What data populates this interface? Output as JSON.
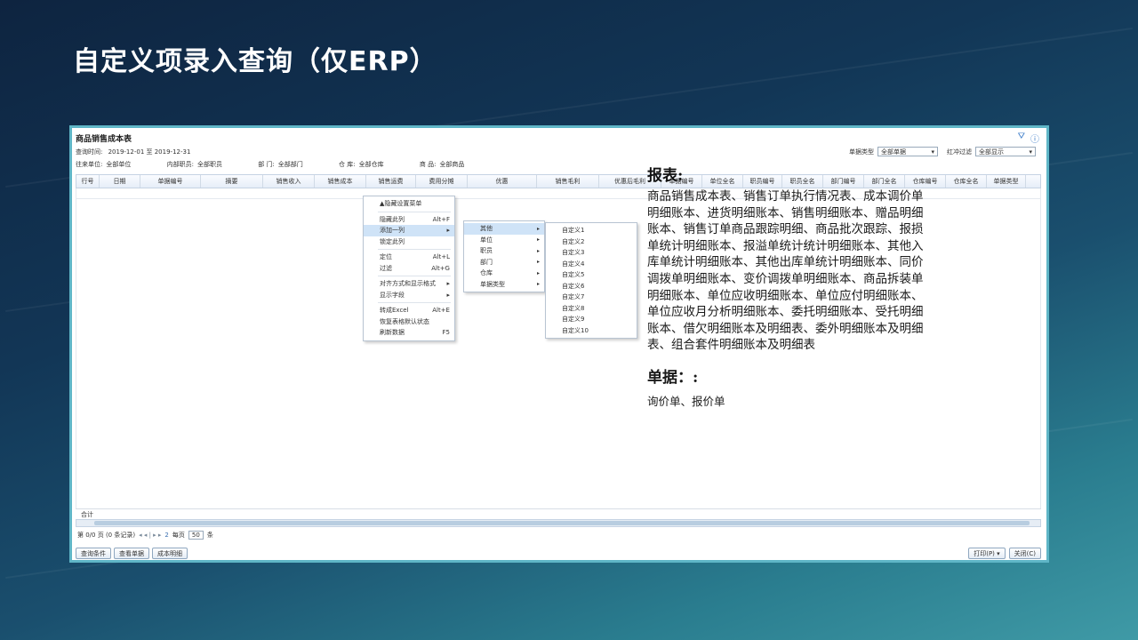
{
  "slide": {
    "title": "自定义项录入查询（仅ERP）"
  },
  "window": {
    "title": "商品销售成本表",
    "filter_icon": "filter-icon",
    "help_icon": "help-icon",
    "date_label": "查询时间:",
    "date_value": "2019-12-01 至 2019-12-31",
    "unit_label": "往来单位:",
    "unit_value": "全部单位",
    "staff_label": "内部职员:",
    "staff_value": "全部职员",
    "dept_label": "部 门:",
    "dept_value": "全部部门",
    "warehouse_label": "仓 库:",
    "warehouse_value": "全部仓库",
    "goods_label": "商 品:",
    "goods_value": "全部商品",
    "doc_type_label": "单据类型",
    "doc_type_value": "全部单据",
    "red_filter_label": "红冲过滤",
    "red_filter_value": "全部显示"
  },
  "columns": [
    "行号",
    "日期",
    "单据编号",
    "摘要",
    "销售收入",
    "销售成本",
    "销售运费",
    "费用分摊",
    "优惠",
    "销售毛利",
    "优惠后毛利",
    "单据编号",
    "单位全名",
    "职员编号",
    "职员全名",
    "部门编号",
    "部门全名",
    "仓库编号",
    "仓库全名",
    "单据类型"
  ],
  "menu1": [
    {
      "label": "▲隐藏设置菜单",
      "shortcut": ""
    },
    {
      "sep": true
    },
    {
      "label": "隐藏此列",
      "shortcut": "Alt+F"
    },
    {
      "label": "添加一列",
      "shortcut": "▸",
      "hl": true
    },
    {
      "label": "锁定此列",
      "shortcut": ""
    },
    {
      "sep": true
    },
    {
      "label": "定位",
      "shortcut": "Alt+L"
    },
    {
      "label": "过滤",
      "shortcut": "Alt+G"
    },
    {
      "sep": true
    },
    {
      "label": "对齐方式和显示格式",
      "shortcut": "▸"
    },
    {
      "label": "显示字段",
      "shortcut": "▸"
    },
    {
      "sep": true
    },
    {
      "label": "转成Excel",
      "shortcut": "Alt+E"
    },
    {
      "label": "恢复表格默认状态",
      "shortcut": ""
    },
    {
      "label": "刷新数据",
      "shortcut": "F5"
    }
  ],
  "menu2": [
    {
      "label": "其他",
      "hl": true
    },
    {
      "label": "单位"
    },
    {
      "label": "职员"
    },
    {
      "label": "部门"
    },
    {
      "label": "仓库"
    },
    {
      "label": "单据类型"
    }
  ],
  "menu3": [
    "自定义1",
    "自定义2",
    "自定义3",
    "自定义4",
    "自定义5",
    "自定义6",
    "自定义7",
    "自定义8",
    "自定义9",
    "自定义10"
  ],
  "footer": {
    "total_label": "合计",
    "page_info": "第 0/0 页 (0 条记录)",
    "nav": "◂ ◂ | ▸ ▸",
    "page_num": "2",
    "per_page_label": "每页",
    "per_page_value": "50",
    "per_page_unit": "条",
    "btn_query": "查询条件",
    "btn_view": "查看单据",
    "btn_cost": "成本明细",
    "btn_print": "打印(P) ▾",
    "btn_close": "关闭(C)"
  },
  "overlay": {
    "head1": "报表:",
    "body1": "商品销售成本表、销售订单执行情况表、成本调价单明细账本、进货明细账本、销售明细账本、赠品明细账本、销售订单商品跟踪明细、商品批次跟踪、报损单统计明细账本、报溢单统计统计明细账本、其他入库单统计明细账本、其他出库单统计明细账本、同价调拨单明细账本、变价调拨单明细账本、商品拆装单明细账本、单位应收明细账本、单位应付明细账本、单位应收月分析明细账本、委托明细账本、受托明细账本、借欠明细账本及明细表、委外明细账本及明细表、组合套件明细账本及明细表",
    "head2": "单据：:",
    "body2": "询价单、报价单"
  }
}
